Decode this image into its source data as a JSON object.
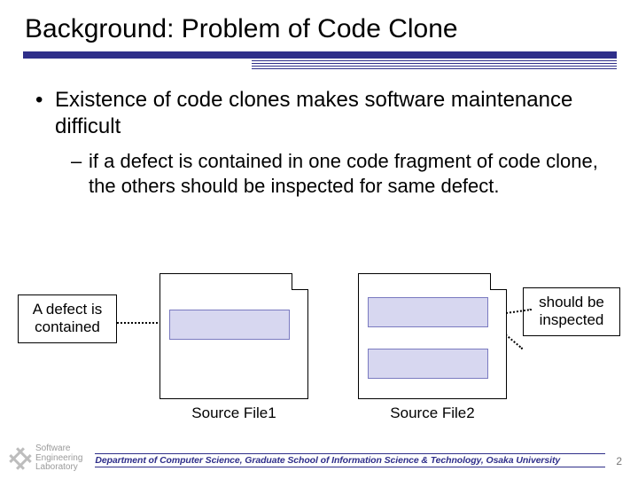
{
  "title": "Background: Problem of Code Clone",
  "bullets": {
    "l1": "Existence of code clones makes software maintenance difficult",
    "l2": "if a defect is contained in one code fragment of code clone, the others should be inspected for same defect."
  },
  "diagram": {
    "callout_left": "A defect is contained",
    "callout_right": "should be inspected",
    "file1_label": "Source File1",
    "file2_label": "Source File2"
  },
  "footer": {
    "logo_line1": "Software",
    "logo_line2": "Engineering",
    "logo_line3": "Laboratory",
    "department": "Department of Computer Science, Graduate School of Information Science & Technology, Osaka University",
    "page_number": "2"
  }
}
